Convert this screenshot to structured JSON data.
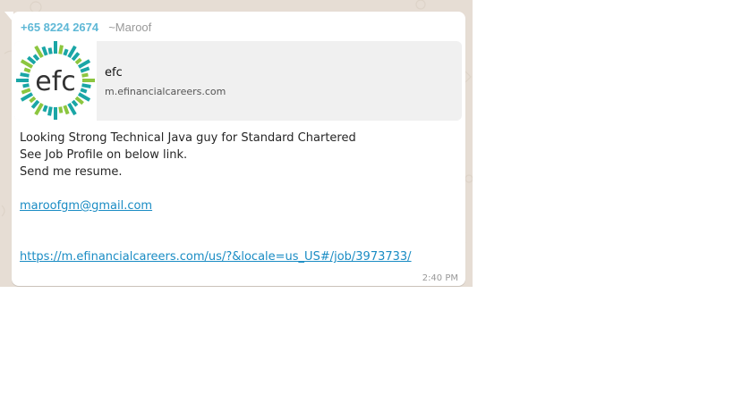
{
  "message": {
    "sender_phone": "+65 8224 2674",
    "sender_name": "~Maroof",
    "link_preview": {
      "logo_text": "efc",
      "title": "efc",
      "domain": "m.efinancialcareers.com"
    },
    "lines": [
      "Looking Strong Technical Java guy for Standard Chartered",
      "See Job Profile on below link.",
      "Send me resume."
    ],
    "email_link": "maroofgm@gmail.com",
    "job_link": "https://m.efinancialcareers.com/us/?&locale=us_US#/job/3973733/",
    "time": "2:40 PM"
  },
  "colors": {
    "chat_background": "#e6ddd4",
    "bubble": "#ffffff",
    "sender_phone": "#5fb8d6",
    "link": "#1a8cc4",
    "logo_teal": "#1aa6a6",
    "logo_green": "#8cc63f"
  }
}
